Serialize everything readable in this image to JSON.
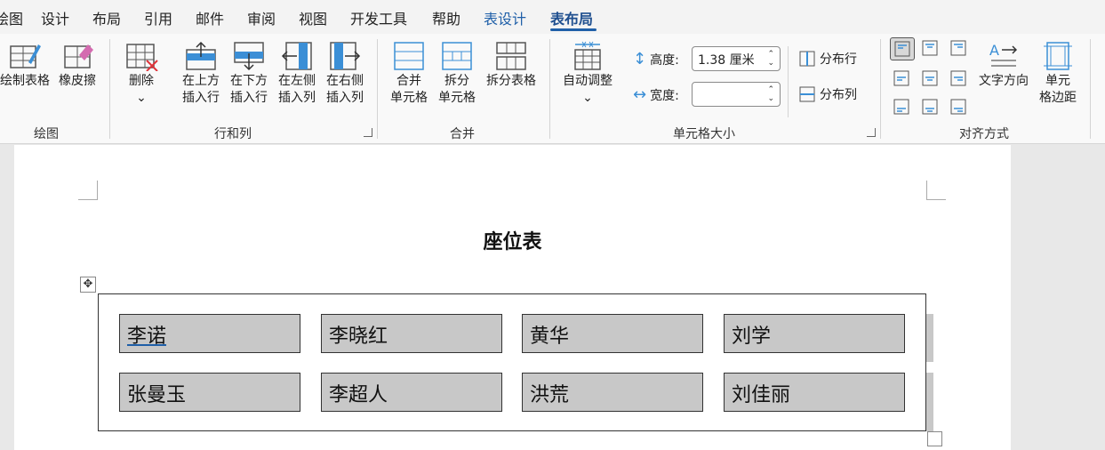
{
  "menu": {
    "tabs": [
      "绘图",
      "设计",
      "布局",
      "引用",
      "邮件",
      "审阅",
      "视图",
      "开发工具",
      "帮助",
      "表设计",
      "表布局"
    ]
  },
  "ribbon": {
    "draw": {
      "label": "绘图",
      "draw_table": "绘制表格",
      "eraser": "橡皮擦"
    },
    "rows_cols": {
      "label": "行和列",
      "delete": "删除",
      "insert_above": [
        "在上方",
        "插入行"
      ],
      "insert_below": [
        "在下方",
        "插入行"
      ],
      "insert_left": [
        "在左侧",
        "插入列"
      ],
      "insert_right": [
        "在右侧",
        "插入列"
      ]
    },
    "merge": {
      "label": "合并",
      "merge_cells": [
        "合并",
        "单元格"
      ],
      "split_cells": [
        "拆分",
        "单元格"
      ],
      "split_table": "拆分表格"
    },
    "cell_size": {
      "label": "单元格大小",
      "autofit": "自动调整",
      "height_label": "高度:",
      "height_value": "1.38 厘米",
      "width_label": "宽度:",
      "width_value": "",
      "distribute_rows": "分布行",
      "distribute_cols": "分布列"
    },
    "alignment": {
      "label": "对齐方式",
      "text_direction": "文字方向",
      "cell_margins": [
        "单元",
        "格边距"
      ]
    }
  },
  "document": {
    "title": "座位表",
    "rows": [
      [
        "李诺",
        "李晓红",
        "黄华",
        "刘学"
      ],
      [
        "张曼玉",
        "李超人",
        "洪荒",
        "刘佳丽"
      ]
    ]
  },
  "colors": {
    "accent": "#1f5fa8",
    "cell_shading": "#c8c8c8",
    "icon_blue": "#3b8fd6"
  }
}
